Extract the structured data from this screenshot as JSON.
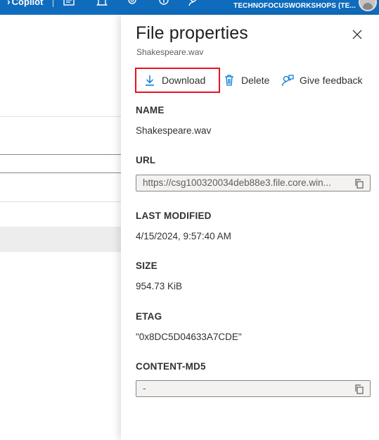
{
  "topbar": {
    "copilot_label": "Copilot",
    "tenant": "TECHNOFOCUSWORKSHOPS (TE...",
    "icons": [
      "feedback-icon",
      "bell-icon",
      "gear-icon",
      "help-icon",
      "person-feedback-icon"
    ]
  },
  "panel": {
    "title": "File properties",
    "subtitle": "Shakespeare.wav",
    "toolbar": {
      "download_label": "Download",
      "delete_label": "Delete",
      "feedback_label": "Give feedback"
    },
    "fields": {
      "name_label": "NAME",
      "name_value": "Shakespeare.wav",
      "url_label": "URL",
      "url_value": "https://csg100320034deb88e3.file.core.win...",
      "last_modified_label": "LAST MODIFIED",
      "last_modified_value": "4/15/2024, 9:57:40 AM",
      "size_label": "SIZE",
      "size_value": "954.73 KiB",
      "etag_label": "ETAG",
      "etag_value": "\"0x8DC5D04633A7CDE\"",
      "md5_label": "CONTENT-MD5",
      "md5_value": "-"
    }
  },
  "colors": {
    "topbar": "#0f6cbd",
    "accent": "#0078d4",
    "highlight_border": "#e81123"
  }
}
